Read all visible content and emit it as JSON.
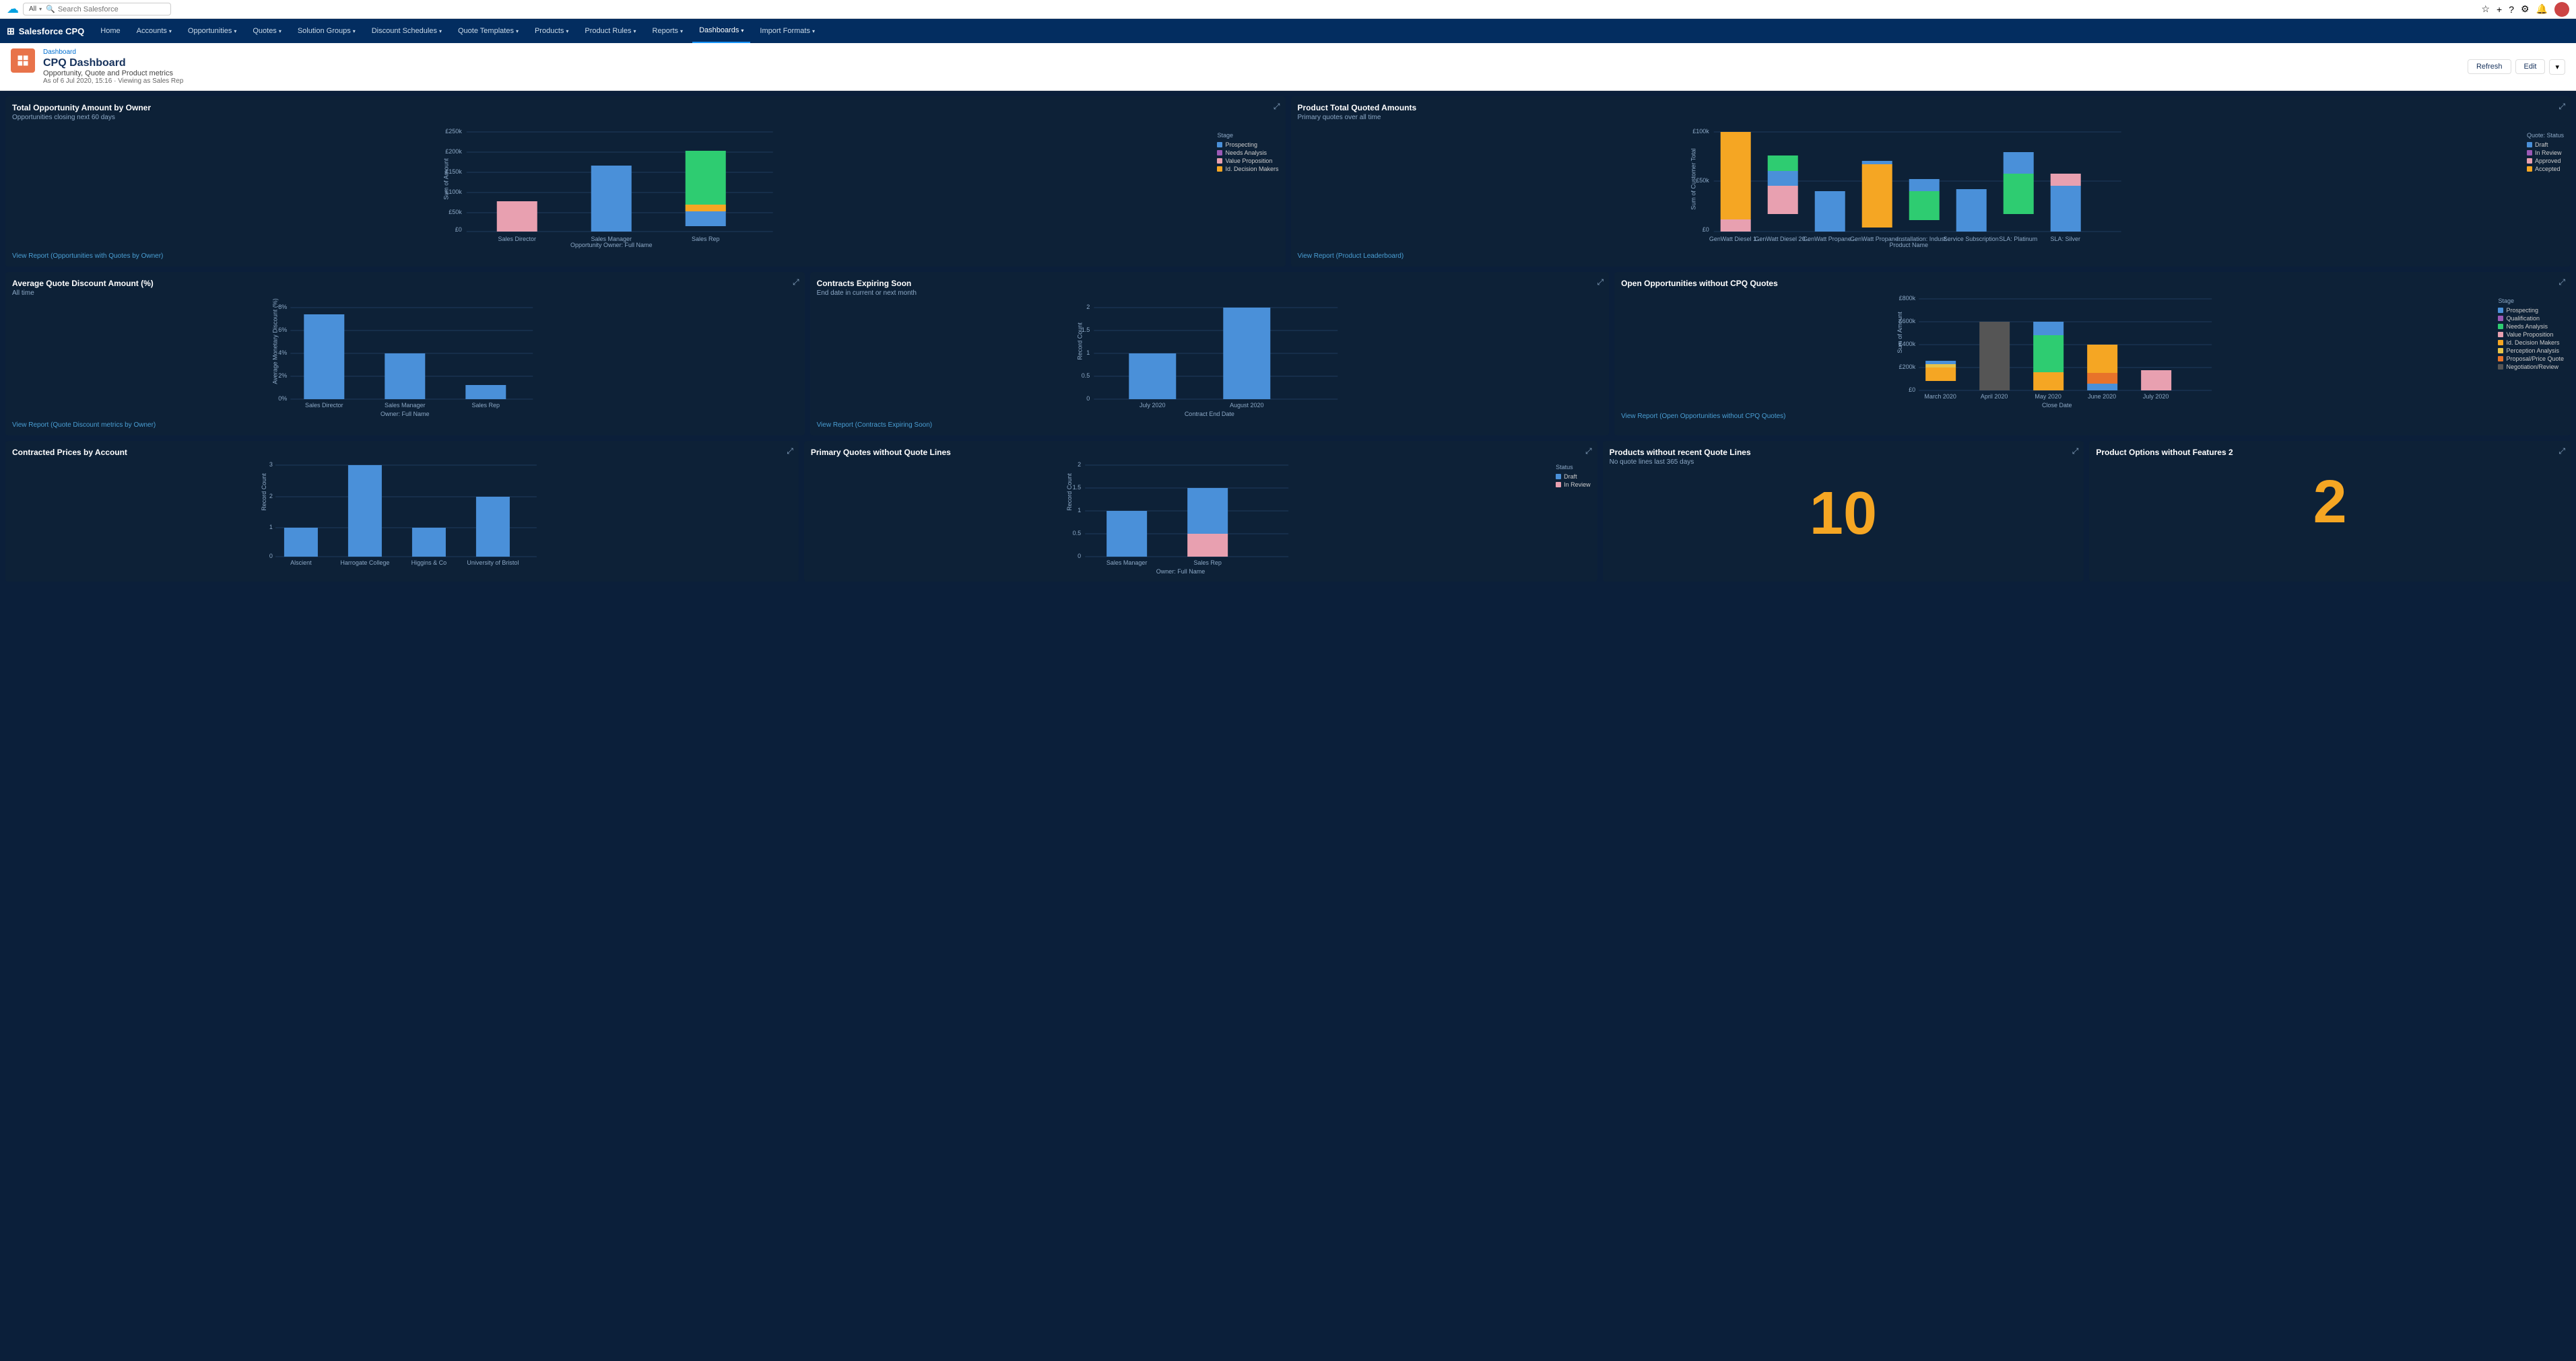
{
  "topbar": {
    "search_placeholder": "Search Salesforce",
    "all_label": "All"
  },
  "mainnav": {
    "logo": "Salesforce CPQ",
    "items": [
      {
        "label": "Home",
        "active": false
      },
      {
        "label": "Accounts",
        "active": false,
        "has_chevron": true
      },
      {
        "label": "Opportunities",
        "active": false,
        "has_chevron": true
      },
      {
        "label": "Quotes",
        "active": false,
        "has_chevron": true
      },
      {
        "label": "Solution Groups",
        "active": false,
        "has_chevron": true
      },
      {
        "label": "Discount Schedules",
        "active": false,
        "has_chevron": true
      },
      {
        "label": "Quote Templates",
        "active": false,
        "has_chevron": true
      },
      {
        "label": "Products",
        "active": false,
        "has_chevron": true
      },
      {
        "label": "Product Rules",
        "active": false,
        "has_chevron": true
      },
      {
        "label": "Reports",
        "active": false,
        "has_chevron": true
      },
      {
        "label": "Dashboards",
        "active": true,
        "has_chevron": true
      },
      {
        "label": "Import Formats",
        "active": false,
        "has_chevron": true
      }
    ]
  },
  "titlebar": {
    "breadcrumb": "Dashboard",
    "title": "CPQ Dashboard",
    "subtitle": "Opportunity, Quote and Product metrics",
    "meta": "As of 6 Jul 2020, 15:16 · Viewing as Sales Rep",
    "refresh_label": "Refresh",
    "edit_label": "Edit"
  },
  "cards": {
    "opp_by_owner": {
      "title": "Total Opportunity Amount by Owner",
      "subtitle": "Opportunities closing next 60 days",
      "view_report": "View Report (Opportunities with Quotes by Owner)",
      "x_axis": "Opportunity Owner: Full Name",
      "y_axis": "Sum of Amount",
      "bars": [
        {
          "label": "Sales Director",
          "segments": [
            {
              "color": "#e8a0b0",
              "value": 60
            }
          ]
        },
        {
          "label": "Sales Manager",
          "segments": [
            {
              "color": "#4a90d9",
              "value": 130
            }
          ]
        },
        {
          "label": "Sales Rep",
          "segments": [
            {
              "color": "#4a90d9",
              "value": 120
            },
            {
              "color": "#2ecc71",
              "value": 150
            },
            {
              "color": "#f5a623",
              "value": 20
            }
          ]
        }
      ],
      "y_labels": [
        "£250k",
        "£200k",
        "£150k",
        "£100k",
        "£50k",
        "£0"
      ],
      "legend": [
        {
          "label": "Prospecting",
          "color": "#4a90d9"
        },
        {
          "label": "Needs Analysis",
          "color": "#9b59b6"
        },
        {
          "label": "Value Proposition",
          "color": "#e8a0b0"
        },
        {
          "label": "Id. Decision Makers",
          "color": "#f5a623"
        }
      ],
      "stage_label": "Stage"
    },
    "product_total": {
      "title": "Product Total Quoted Amounts",
      "subtitle": "Primary quotes over all time",
      "view_report": "View Report (Product Leaderboard)",
      "x_axis": "Product Name",
      "y_axis": "Sum of Customer Total",
      "bars": [
        {
          "label": "GenWatt Diesel 1...",
          "segments": [
            {
              "color": "#f5a623",
              "value": 180
            },
            {
              "color": "#e8a0b0",
              "value": 20
            }
          ]
        },
        {
          "label": "GenWatt Diesel 20...",
          "segments": [
            {
              "color": "#e8a0b0",
              "value": 60
            },
            {
              "color": "#4a90d9",
              "value": 50
            },
            {
              "color": "#2ecc71",
              "value": 30
            }
          ]
        },
        {
          "label": "GenWatt Propane ...",
          "segments": [
            {
              "color": "#4a90d9",
              "value": 55
            }
          ]
        },
        {
          "label": "GenWatt Propane ...",
          "segments": [
            {
              "color": "#f5a623",
              "value": 90
            },
            {
              "color": "#4a90d9",
              "value": 5
            }
          ]
        },
        {
          "label": "Installation: Indust...",
          "segments": [
            {
              "color": "#2ecc71",
              "value": 55
            },
            {
              "color": "#4a90d9",
              "value": 20
            }
          ]
        },
        {
          "label": "Service Subscription",
          "segments": [
            {
              "color": "#4a90d9",
              "value": 70
            }
          ]
        },
        {
          "label": "SLA: Platinum",
          "segments": [
            {
              "color": "#2ecc71",
              "value": 80
            },
            {
              "color": "#4a90d9",
              "value": 40
            }
          ]
        },
        {
          "label": "SLA: Silver",
          "segments": [
            {
              "color": "#4a90d9",
              "value": 80
            },
            {
              "color": "#e8a0b0",
              "value": 20
            }
          ]
        }
      ],
      "y_labels": [
        "£100k",
        "£50k",
        "£0"
      ],
      "legend": [
        {
          "label": "Draft",
          "color": "#4a90d9"
        },
        {
          "label": "In Review",
          "color": "#9b59b6"
        },
        {
          "label": "Approved",
          "color": "#e8a0b0"
        },
        {
          "label": "Accepted",
          "color": "#f5a623"
        }
      ],
      "quote_status_label": "Quote: Status"
    },
    "avg_discount": {
      "title": "Average Quote Discount Amount (%)",
      "subtitle": "All time",
      "view_report": "View Report (Quote Discount metrics by Owner)",
      "x_axis": "Owner: Full Name",
      "y_axis": "Average Monetary Discount (%)",
      "bars": [
        {
          "label": "Sales Director",
          "value": 70,
          "color": "#4a90d9"
        },
        {
          "label": "Sales Manager",
          "value": 40,
          "color": "#4a90d9"
        },
        {
          "label": "Sales Rep",
          "value": 15,
          "color": "#4a90d9"
        }
      ],
      "y_labels": [
        "8%",
        "6%",
        "4%",
        "2%",
        "0%"
      ]
    },
    "contracts_expiring": {
      "title": "Contracts Expiring Soon",
      "subtitle": "End date in current or next month",
      "view_report": "View Report (Contracts Expiring Soon)",
      "x_axis": "Contract End Date",
      "y_axis": "Record Count",
      "bars": [
        {
          "label": "July 2020",
          "value": 1,
          "color": "#4a90d9"
        },
        {
          "label": "August 2020",
          "value": 2,
          "color": "#4a90d9"
        }
      ],
      "y_labels": [
        "2",
        "1.5",
        "1",
        "0.5",
        "0"
      ]
    },
    "open_opp": {
      "title": "Open Opportunities without CPQ Quotes",
      "subtitle": "",
      "view_report": "View Report (Open Opportunities without CPQ Quotes)",
      "x_axis": "Close Date",
      "y_axis": "Sum of Amount",
      "bars": [
        {
          "label": "March 2020",
          "segments": [
            {
              "color": "#f5a623",
              "value": 30
            },
            {
              "color": "#e8c44a",
              "value": 5
            },
            {
              "color": "#4a90d9",
              "value": 5
            }
          ]
        },
        {
          "label": "April 2020",
          "segments": [
            {
              "color": "#555",
              "value": 80
            }
          ]
        },
        {
          "label": "May 2020",
          "segments": [
            {
              "color": "#4a90d9",
              "value": 20
            },
            {
              "color": "#2ecc71",
              "value": 120
            },
            {
              "color": "#f5a623",
              "value": 30
            }
          ]
        },
        {
          "label": "June 2020",
          "segments": [
            {
              "color": "#f5a623",
              "value": 80
            },
            {
              "color": "#e8732a",
              "value": 40
            },
            {
              "color": "#4a90d9",
              "value": 20
            }
          ]
        },
        {
          "label": "July 2020",
          "segments": [
            {
              "color": "#e8a0b0",
              "value": 40
            }
          ]
        }
      ],
      "y_labels": [
        "£800k",
        "£600k",
        "£400k",
        "£200k",
        "£0"
      ],
      "legend": [
        {
          "label": "Prospecting",
          "color": "#4a90d9"
        },
        {
          "label": "Qualification",
          "color": "#9b59b6"
        },
        {
          "label": "Needs Analysis",
          "color": "#2ecc71"
        },
        {
          "label": "Value Proposition",
          "color": "#e8a0b0"
        },
        {
          "label": "Id. Decision Makers",
          "color": "#f5a623"
        },
        {
          "label": "Perception Analysis",
          "color": "#e8c44a"
        },
        {
          "label": "Proposal/Price Quote",
          "color": "#e8732a"
        },
        {
          "label": "Negotiation/Review",
          "color": "#555"
        }
      ],
      "stage_label": "Stage"
    },
    "contracted_prices": {
      "title": "Contracted Prices by Account",
      "subtitle": "",
      "view_report": "",
      "x_axis": "",
      "y_axis": "Record Count",
      "bars": [
        {
          "label": "Alscient",
          "value": 1,
          "color": "#4a90d9"
        },
        {
          "label": "Harrogate College",
          "value": 3,
          "color": "#4a90d9"
        },
        {
          "label": "Higgins & Co",
          "value": 1,
          "color": "#4a90d9"
        },
        {
          "label": "University of Bristol",
          "value": 2,
          "color": "#4a90d9"
        }
      ],
      "y_labels": [
        "3",
        "2",
        "1",
        "0"
      ]
    },
    "primary_quotes": {
      "title": "Primary Quotes without Quote Lines",
      "subtitle": "",
      "view_report": "",
      "x_axis": "Owner: Full Name",
      "y_axis": "Record Count",
      "bars": [
        {
          "label": "Sales Manager",
          "segments": [
            {
              "color": "#4a90d9",
              "value": 1
            }
          ]
        },
        {
          "label": "Sales Rep",
          "segments": [
            {
              "color": "#4a90d9",
              "value": 1.5
            },
            {
              "color": "#e8a0b0",
              "value": 0.5
            }
          ]
        }
      ],
      "y_labels": [
        "2",
        "1.5",
        "1",
        "0.5",
        "0"
      ],
      "legend": [
        {
          "label": "Draft",
          "color": "#4a90d9"
        },
        {
          "label": "In Review",
          "color": "#e8a0b0"
        }
      ],
      "status_label": "Status"
    },
    "products_no_quotes": {
      "title": "Products without recent Quote Lines",
      "subtitle": "No quote lines last 365 days",
      "value": "10",
      "value_color": "#f5a623"
    },
    "product_options": {
      "title": "Product Options without Features 2",
      "value": "2",
      "value_color": "#f5a623"
    }
  }
}
